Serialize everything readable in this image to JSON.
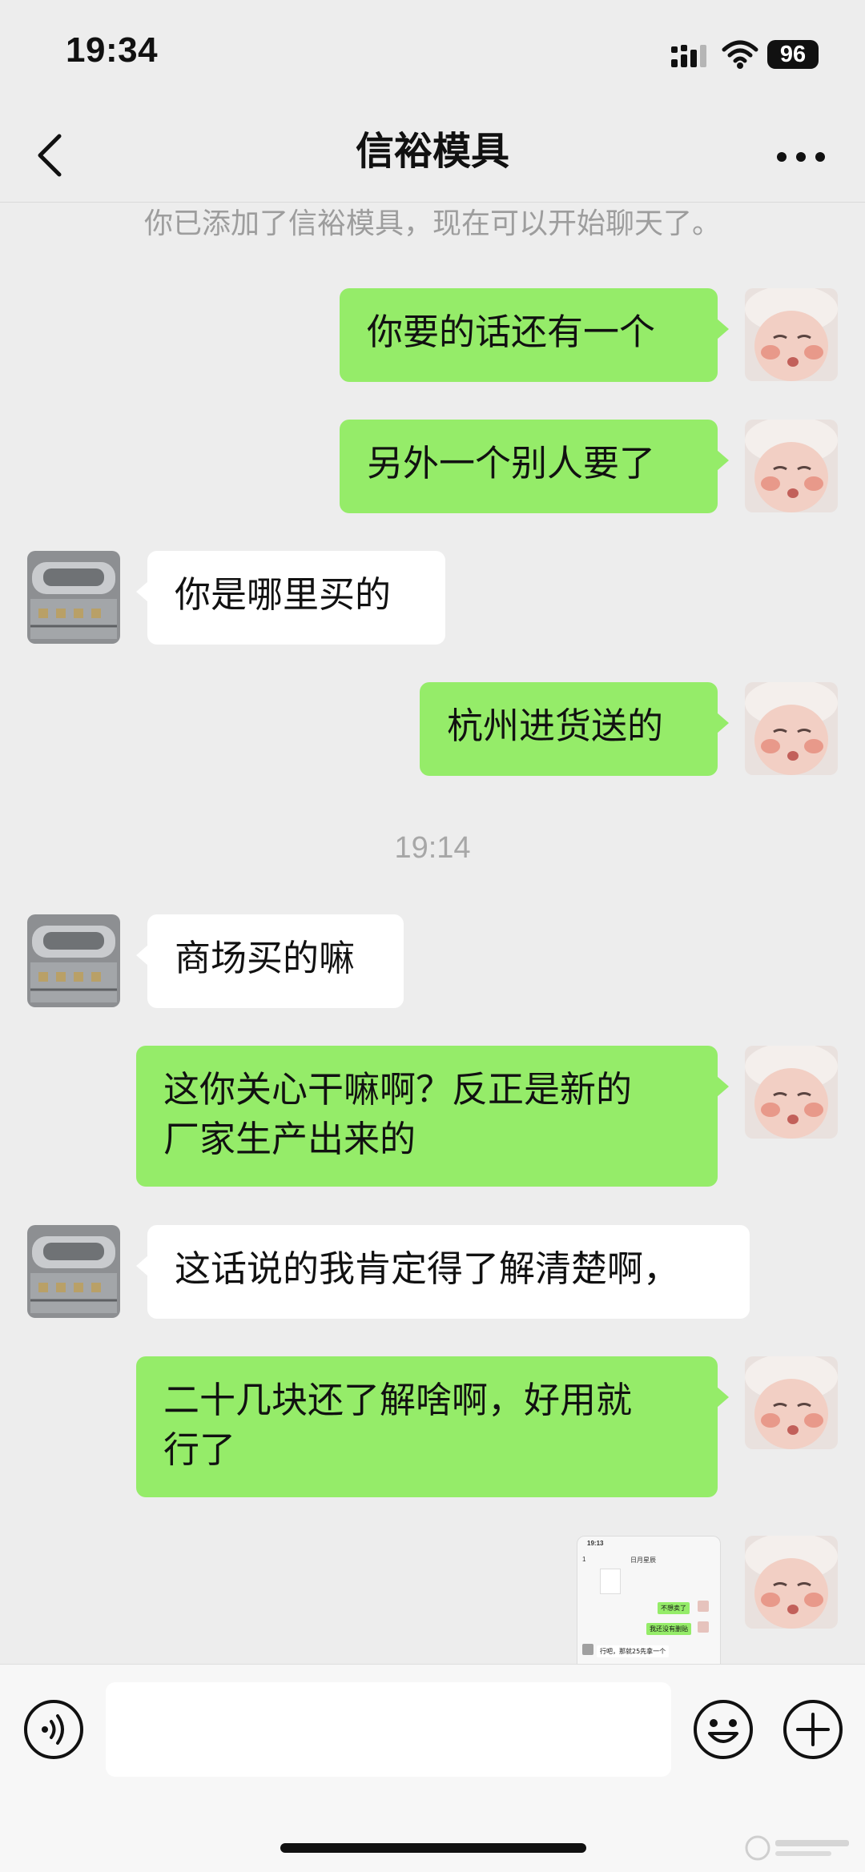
{
  "status_bar": {
    "time": "19:34",
    "battery": "96",
    "icons": [
      "signal-icon",
      "wifi-icon",
      "battery-icon"
    ]
  },
  "nav": {
    "title": "信裕模具",
    "icons": [
      "chevron-left-icon",
      "more-icon"
    ]
  },
  "chat": {
    "system_notice": "你已添加了信裕模具，现在可以开始聊天了。",
    "time_divider": "19:14",
    "messages": [
      {
        "from": "me",
        "type": "text",
        "lines": [
          "你要的话还有一个"
        ]
      },
      {
        "from": "me",
        "type": "text",
        "lines": [
          "另外一个别人要了"
        ]
      },
      {
        "from": "them",
        "type": "text",
        "lines": [
          "你是哪里买的"
        ]
      },
      {
        "from": "me",
        "type": "text",
        "lines": [
          "杭州进货送的"
        ]
      },
      {
        "from": "them",
        "type": "text",
        "lines": [
          "商场买的嘛"
        ]
      },
      {
        "from": "me",
        "type": "text",
        "lines": [
          "这你关心干嘛啊？反正是新的",
          "厂家生产出来的"
        ]
      },
      {
        "from": "them",
        "type": "text",
        "lines": [
          "这话说的我肯定得了解清楚啊，"
        ]
      },
      {
        "from": "me",
        "type": "text",
        "lines": [
          "二十几块还了解啥啊，好用就",
          "行了"
        ]
      },
      {
        "from": "me",
        "type": "image",
        "screenshot": {
          "time": "19:13",
          "title": "日月星辰",
          "back_count": "1",
          "bubbles": [
            "不想卖了",
            "我还没有删贴",
            "行吧，那就25先拿一个"
          ]
        }
      }
    ]
  },
  "input_bar": {
    "placeholder": "",
    "value": "",
    "icons": [
      "voice-icon",
      "emoji-icon",
      "plus-icon"
    ]
  },
  "colors": {
    "background": "#ededed",
    "my_bubble": "#95ec69",
    "their_bubble": "#ffffff",
    "notice_text": "#9d9d9d"
  }
}
